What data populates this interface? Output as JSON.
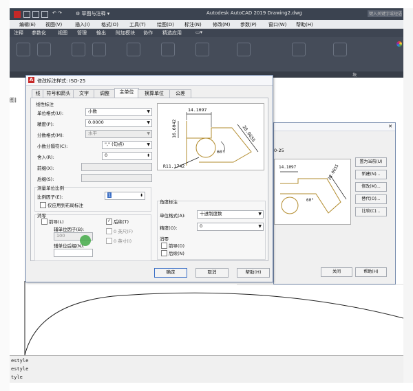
{
  "app": {
    "title": "Autodesk AutoCAD 2019    Drawing2.dwg",
    "workspace": "草图与注释",
    "search_placeholder": "键入关键字或短语"
  },
  "menu": [
    "编辑(E)",
    "视图(V)",
    "插入(I)",
    "格式(O)",
    "工具(T)",
    "绘图(D)",
    "标注(N)",
    "修改(M)",
    "参数(P)",
    "窗口(W)",
    "帮助(H)"
  ],
  "ribbon_tabs": [
    "注释",
    "参数化",
    "视图",
    "管理",
    "输出",
    "附加模块",
    "协作",
    "精选应用"
  ],
  "ribbon_right_label": "块",
  "left_stub": "图]",
  "command_lines": [
    "estyle",
    "estyle",
    "tyle"
  ],
  "dialog": {
    "title": "修改标注样式: ISO-25",
    "tabs": [
      "线",
      "符号和箭头",
      "文字",
      "调整",
      "主单位",
      "换算单位",
      "公差"
    ],
    "linear_section": "线性标注",
    "unit_format_label": "单位格式(U):",
    "unit_format_value": "小数",
    "precision_label": "精度(P):",
    "precision_value": "0.0000",
    "fraction_label": "分数格式(M):",
    "fraction_value": "水平",
    "decimal_sep_label": "小数分隔符(C):",
    "decimal_sep_value": "\",\" (句点)",
    "round_off_label": "舍入(R):",
    "round_off_value": "0",
    "prefix_label": "前缀(X):",
    "suffix_label": "后缀(S):",
    "measure_scale_section": "测量单位比例",
    "scale_factor_label": "比例因子(E):",
    "scale_factor_value": "1",
    "layout_only_label": "仅应用到布局标注",
    "zero_section": "消零",
    "leading_label": "前导(L)",
    "sub_unit_factor_label": "辅单位因子(B):",
    "sub_unit_factor_value": "100",
    "sub_unit_suffix_label": "辅单位后缀(N):",
    "trailing_label": "后续(T)",
    "feet_label": "0 英尺(F)",
    "inches_label": "0 英寸(I)",
    "angular_section": "角度标注",
    "ang_unit_label": "单位格式(A):",
    "ang_unit_value": "十进制度数",
    "ang_precision_label": "精度(O):",
    "ang_precision_value": "0",
    "ang_zero_section": "消零",
    "ang_leading_label": "前导(D)",
    "ang_trailing_label": "后续(N)",
    "ok_label": "确定",
    "cancel_label": "取消",
    "help_label": "帮助(H)",
    "preview": {
      "dim_top": "14.1097",
      "dim_left": "16.6042",
      "dim_right": "28.0655",
      "dim_angle": "60°",
      "dim_radius": "R11.1742"
    }
  },
  "bg_dialog": {
    "style_name": "0-25",
    "preview_top": "14.1097",
    "preview_right": "28.0655",
    "preview_angle": "60°",
    "buttons": [
      "置为当前(U)",
      "新建(N)...",
      "修改(M)...",
      "替代(O)...",
      "比较(C)..."
    ],
    "close_label": "关闭",
    "help_label": "帮助(H)"
  }
}
